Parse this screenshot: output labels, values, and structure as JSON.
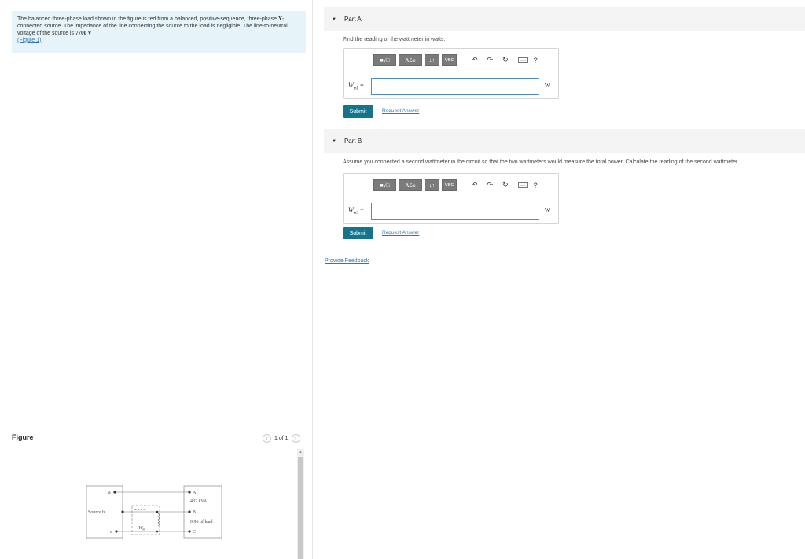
{
  "problem": {
    "text_1": "The balanced three-phase load shown in the figure is fed from a balanced, positive-sequence, three-phase ",
    "y_symbol": "Y",
    "text_2": "-connected source. The impedance of the line connecting the source to the load is negligible. The line-to-neutral voltage of the source is ",
    "voltage": "7700 V",
    "figure_link": "(Figure 1)"
  },
  "figure": {
    "label": "Figure",
    "pager": "1 of 1",
    "circuit": {
      "node_a": "a",
      "source_label": "Source b",
      "node_c": "c",
      "node_A": "A",
      "node_B": "B",
      "node_C": "C",
      "load_kva": "432 kVA",
      "load_pf": "0.96 pf lead",
      "wattmeter": "W",
      "wattmeter_sub": "m"
    }
  },
  "part_a": {
    "title": "Part A",
    "prompt": "Find the reading of the wattmeter in watts.",
    "var_main": "W",
    "var_sub": "m1",
    "equals": "=",
    "unit": "W",
    "submit": "Submit",
    "request": "Request Answer"
  },
  "part_b": {
    "title": "Part B",
    "prompt": "Assume you connected a second wattmeter in the circuit so that the two wattmeters would measure the total power. Calculate the reading of the second wattmeter.",
    "var_main": "W",
    "var_sub": "m2",
    "equals": "=",
    "unit": "W",
    "submit": "Submit",
    "request": "Request Answer"
  },
  "toolbar": {
    "template": "■√□",
    "greek": "ΑΣφ",
    "arrows": "↓↑",
    "vec": "vec",
    "undo": "↶",
    "redo": "↷",
    "reset": "↻",
    "keyboard": "▭▭",
    "help": "?"
  },
  "feedback": "Provide Feedback",
  "colors": {
    "submit": "#14748c",
    "link": "#2f79b3",
    "problem_bg": "#e6f3f8"
  }
}
